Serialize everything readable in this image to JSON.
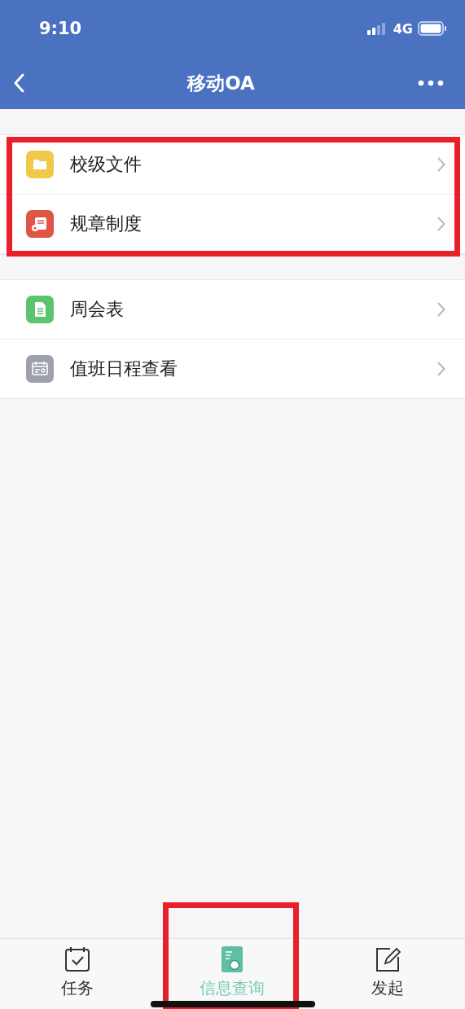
{
  "status_bar": {
    "time": "9:10",
    "network": "4G"
  },
  "nav_bar": {
    "title": "移动OA"
  },
  "sections": [
    {
      "highlighted": true,
      "items": [
        {
          "label": "校级文件",
          "color": "#f0c94a"
        },
        {
          "label": "规章制度",
          "color": "#e05645"
        }
      ]
    },
    {
      "highlighted": false,
      "items": [
        {
          "label": "周会表",
          "color": "#5cc46e"
        },
        {
          "label": "值班日程查看",
          "color": "#9da1ab"
        }
      ]
    }
  ],
  "tab_bar": [
    {
      "label": "任务",
      "selected": false,
      "highlighted": false
    },
    {
      "label": "信息查询",
      "selected": true,
      "highlighted": true
    },
    {
      "label": "发起",
      "selected": false,
      "highlighted": false
    }
  ]
}
